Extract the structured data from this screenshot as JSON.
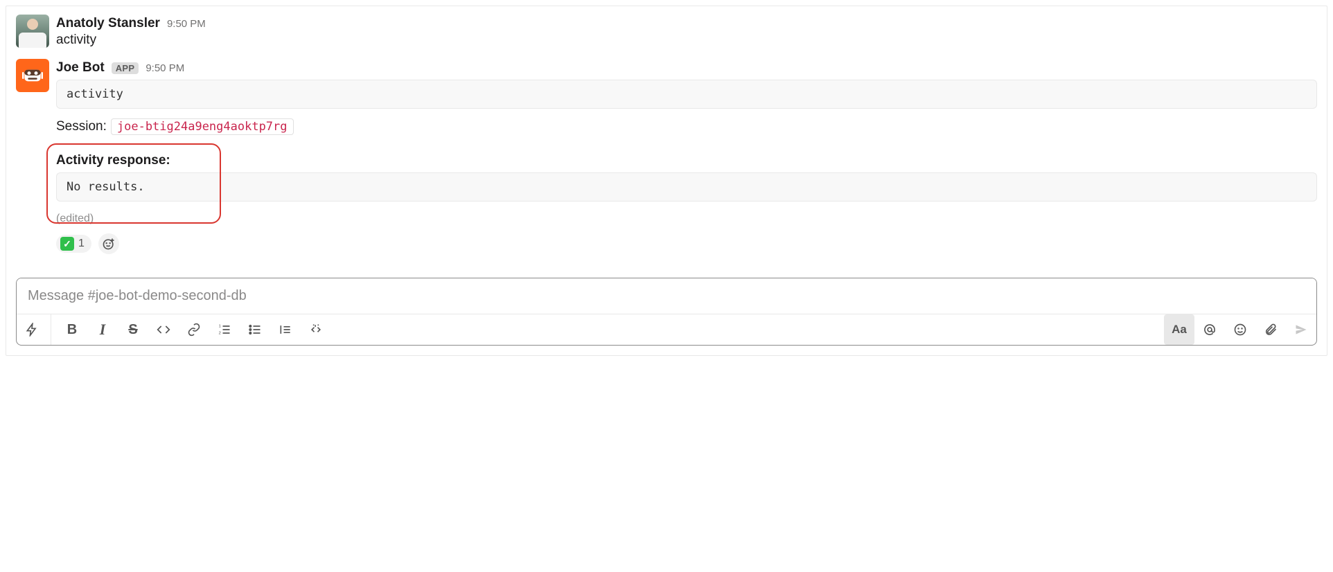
{
  "messages": {
    "user": {
      "sender": "Anatoly Stansler",
      "time": "9:50 PM",
      "text": "activity"
    },
    "bot": {
      "sender": "Joe Bot",
      "app_badge": "APP",
      "time": "9:50 PM",
      "code": "activity",
      "session_label": "Session:",
      "session_id": "joe-btig24a9eng4aoktp7rg",
      "response_header": "Activity response:",
      "response_body": "No results.",
      "edited": "(edited)",
      "reaction_count": "1"
    }
  },
  "composer": {
    "placeholder": "Message #joe-bot-demo-second-db",
    "aa_label": "Aa"
  }
}
